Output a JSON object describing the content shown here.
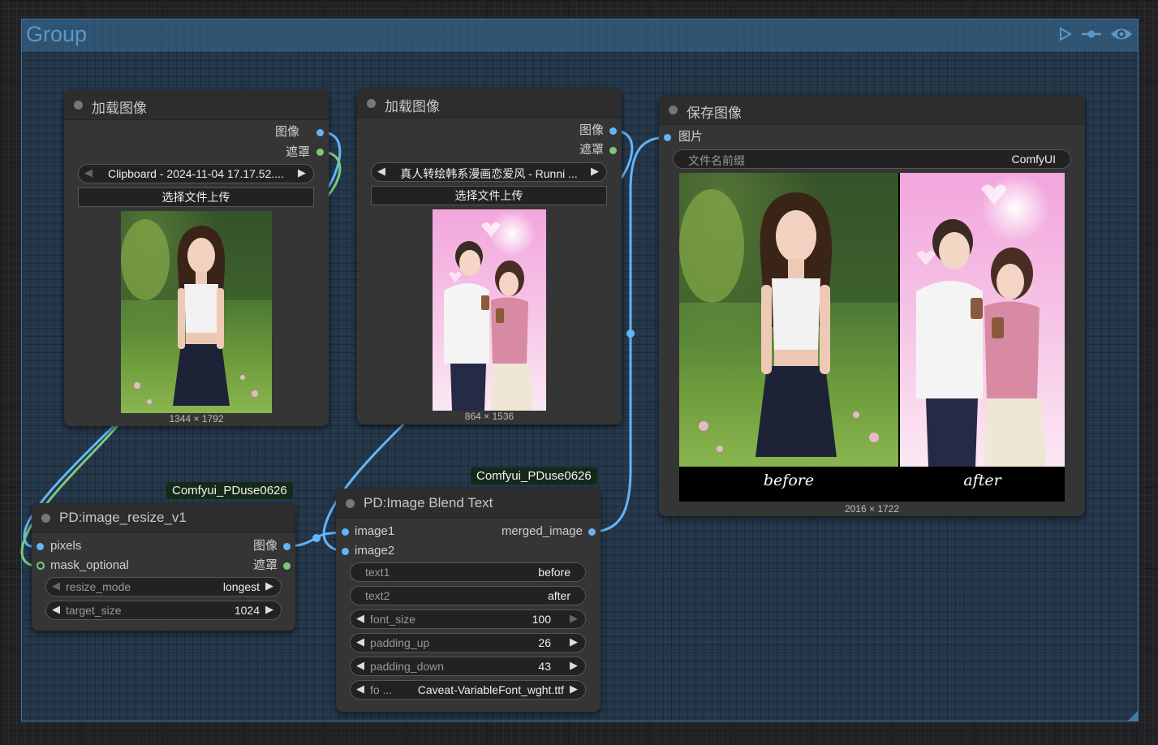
{
  "group": {
    "title": "Group"
  },
  "badge_text": "Comfyui_PDuse0626",
  "load1": {
    "title": "加载图像",
    "out_image": "图像",
    "out_mask": "遮罩",
    "file": "Clipboard - 2024-11-04 17.17.52....",
    "upload": "选择文件上传",
    "resolution": "1344 × 1792"
  },
  "load2": {
    "title": "加载图像",
    "out_image": "图像",
    "out_mask": "遮罩",
    "file": "真人转绘韩系漫画恋爱风 - Runni ...",
    "upload": "选择文件上传",
    "resolution": "864 × 1536"
  },
  "save": {
    "title": "保存图像",
    "in_images": "图片",
    "prefix_label": "文件名前缀",
    "prefix_value": "ComfyUI",
    "caption_before": "before",
    "caption_after": "after",
    "resolution": "2016 × 1722"
  },
  "resize": {
    "title": "PD:image_resize_v1",
    "in_pixels": "pixels",
    "in_mask": "mask_optional",
    "out_image": "图像",
    "out_mask": "遮罩",
    "mode_label": "resize_mode",
    "mode_value": "longest",
    "size_label": "target_size",
    "size_value": "1024"
  },
  "blend": {
    "title": "PD:Image Blend Text",
    "in_image1": "image1",
    "in_image2": "image2",
    "out_merged": "merged_image",
    "text1_label": "text1",
    "text1_value": "before",
    "text2_label": "text2",
    "text2_value": "after",
    "font_size_label": "font_size",
    "font_size_value": "100",
    "padding_up_label": "padding_up",
    "padding_up_value": "26",
    "padding_down_label": "padding_down",
    "padding_down_value": "43",
    "font_label": "fo ...",
    "font_value": "Caveat-VariableFont_wght.ttf"
  },
  "colors": {
    "image_wire": "#64b5f6",
    "mask_wire": "#7ec87e",
    "group_border": "#3a7bb0",
    "node_bg": "#353535"
  }
}
